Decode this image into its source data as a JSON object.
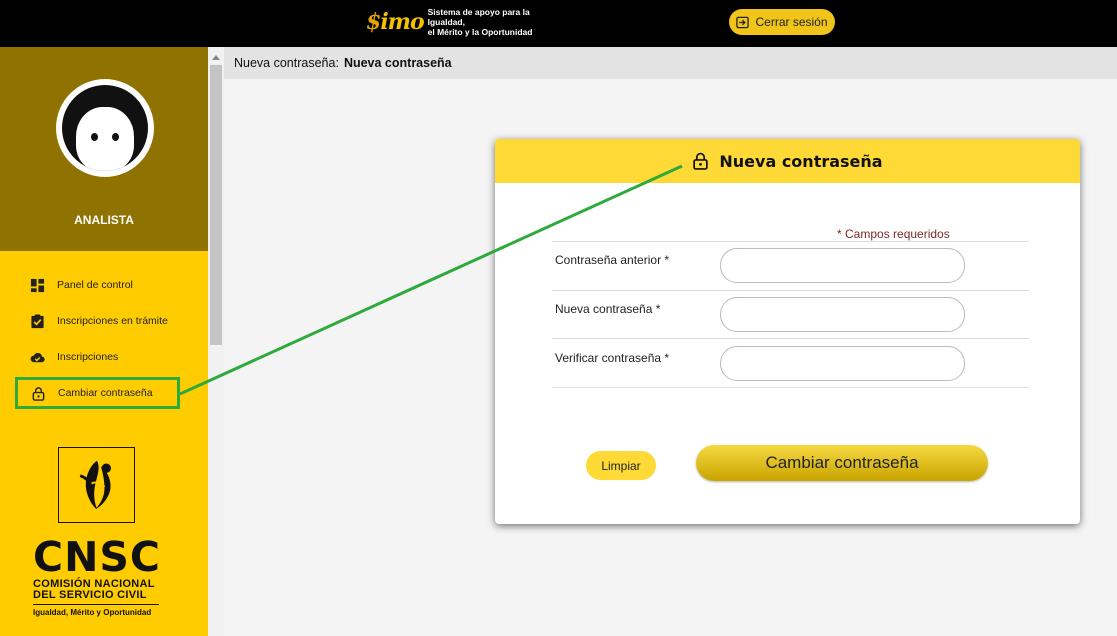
{
  "header": {
    "logo_mark": "SIMO",
    "logo_line1": "Sistema de apoyo para la Igualdad,",
    "logo_line2": "el Mérito y la Oportunidad",
    "logout_label": "Cerrar sesión"
  },
  "sidebar": {
    "role": "ANALISTA",
    "items": [
      {
        "label": "Panel de control",
        "icon": "dashboard-icon"
      },
      {
        "label": "Inscripciones en trámite",
        "icon": "check-square-icon"
      },
      {
        "label": "Inscripciones",
        "icon": "cloud-check-icon"
      },
      {
        "label": "Cambiar contraseña",
        "icon": "lock-icon"
      }
    ],
    "org": {
      "acronym": "CNSC",
      "name_line1": "COMISIÓN NACIONAL",
      "name_line2": "DEL SERVICIO CIVIL",
      "tagline": "Igualdad, Mérito y Oportunidad"
    }
  },
  "breadcrumb": {
    "prefix": "Nueva contraseña:",
    "current": "Nueva contraseña"
  },
  "form": {
    "title": "Nueva contraseña",
    "required_note": "* Campos requeridos",
    "fields": [
      {
        "label": "Contraseña anterior *",
        "value": ""
      },
      {
        "label": "Nueva contraseña *",
        "value": ""
      },
      {
        "label": "Verificar contraseña *",
        "value": ""
      }
    ],
    "clear_label": "Limpiar",
    "submit_label": "Cambiar contraseña"
  },
  "colors": {
    "accent": "#ffcc00",
    "sidebar_top": "#8f7200",
    "highlight": "#2daa3b"
  }
}
